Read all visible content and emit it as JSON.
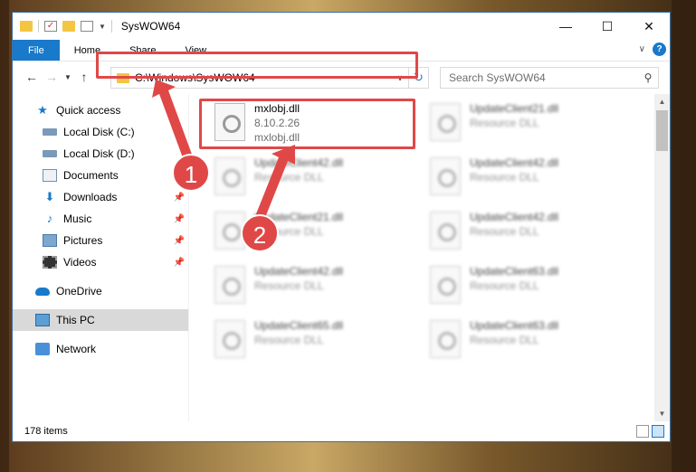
{
  "window": {
    "title": "SysWOW64"
  },
  "ribbon": {
    "tabs": [
      "File",
      "Home",
      "Share",
      "View"
    ]
  },
  "address": {
    "path": "C:\\Windows\\SysWOW64"
  },
  "search": {
    "placeholder": "Search SysWOW64"
  },
  "sidebar": {
    "items": [
      {
        "label": "Quick access",
        "icon": "star-icon"
      },
      {
        "label": "Local Disk (C:)",
        "icon": "drive-icon"
      },
      {
        "label": "Local Disk (D:)",
        "icon": "drive-icon"
      },
      {
        "label": "Documents",
        "icon": "documents-icon"
      },
      {
        "label": "Downloads",
        "icon": "download-icon"
      },
      {
        "label": "Music",
        "icon": "music-icon"
      },
      {
        "label": "Pictures",
        "icon": "pictures-icon"
      },
      {
        "label": "Videos",
        "icon": "videos-icon"
      },
      {
        "label": "OneDrive",
        "icon": "cloud-icon"
      },
      {
        "label": "This PC",
        "icon": "computer-icon"
      },
      {
        "label": "Network",
        "icon": "network-icon"
      }
    ]
  },
  "files": [
    {
      "name": "mxlobj.dll",
      "line2": "8.10.2.26",
      "line3": "mxlobj.dll"
    },
    {
      "name": "UpdateClient21.dll",
      "line2": "Resource DLL"
    },
    {
      "name": "UpdateClient42.dll",
      "line2": "Resource DLL"
    },
    {
      "name": "UpdateClient42.dll",
      "line2": "Resource DLL"
    },
    {
      "name": "UpdateClient21.dll",
      "line2": "Resource DLL"
    },
    {
      "name": "UpdateClient42.dll",
      "line2": "Resource DLL"
    },
    {
      "name": "UpdateClient42.dll",
      "line2": "Resource DLL"
    },
    {
      "name": "UpdateClient63.dll",
      "line2": "Resource DLL"
    },
    {
      "name": "UpdateClient65.dll",
      "line2": "Resource DLL"
    },
    {
      "name": "UpdateClient63.dll",
      "line2": "Resource DLL"
    }
  ],
  "status": {
    "count": "178 items"
  },
  "annotations": {
    "badge1": "1",
    "badge2": "2",
    "color": "#e04848"
  }
}
